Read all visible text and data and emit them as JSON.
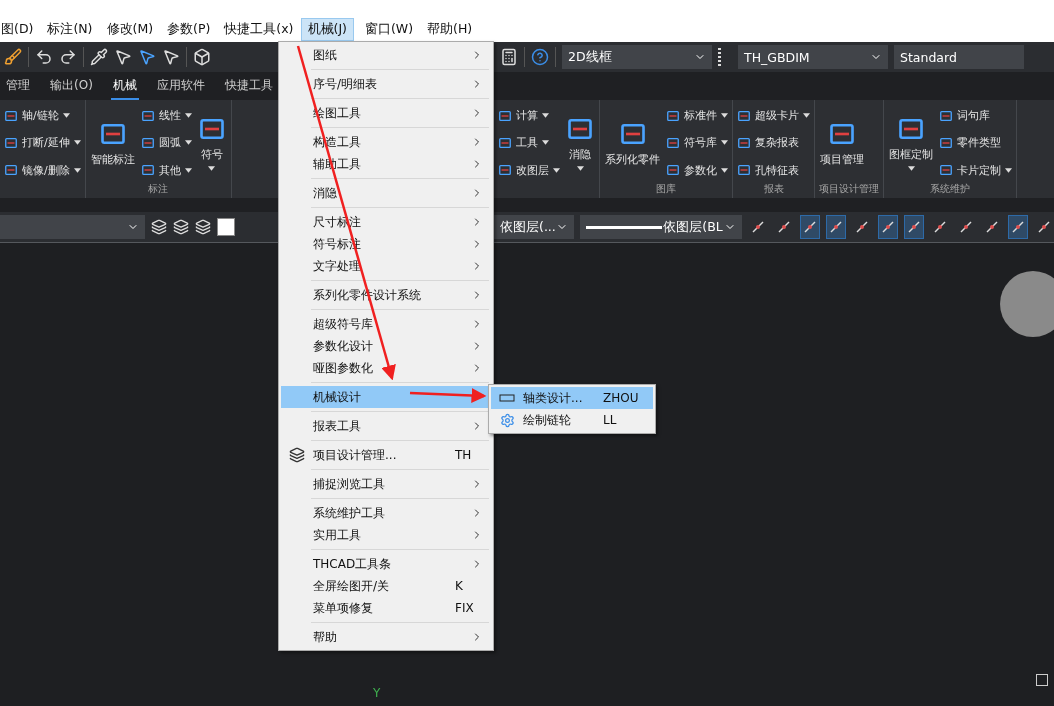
{
  "menubar": [
    {
      "label": "图(D)",
      "selected": false
    },
    {
      "label": "标注(N)",
      "selected": false
    },
    {
      "label": "修改(M)",
      "selected": false
    },
    {
      "label": "参数(P)",
      "selected": false
    },
    {
      "label": "快捷工具(x)",
      "selected": false
    },
    {
      "label": "机械(J)",
      "selected": true
    },
    {
      "label": "窗口(W)",
      "selected": false
    },
    {
      "label": "帮助(H)",
      "selected": false
    }
  ],
  "toolbar": {
    "visual_style": "2D线框",
    "dim_style": "TH_GBDIM",
    "text_style": "Standard"
  },
  "ribbon_tabs": [
    {
      "label": "管理",
      "selected": false
    },
    {
      "label": "输出(O)",
      "selected": false
    },
    {
      "label": "机械",
      "selected": true
    },
    {
      "label": "应用软件",
      "selected": false
    },
    {
      "label": "快捷工具",
      "selected": false
    }
  ],
  "ribbon_left": [
    {
      "buttons": [
        {
          "kind": "stack",
          "items": [
            {
              "label": "轴/链轮",
              "caret": true
            },
            {
              "label": "打断/延伸",
              "caret": true
            },
            {
              "label": "镜像/删除",
              "caret": true
            }
          ]
        }
      ]
    },
    {
      "title": "标注",
      "buttons": [
        {
          "kind": "large",
          "label": "智能标注",
          "caret": false
        },
        {
          "kind": "stack",
          "items": [
            {
              "label": "线性",
              "caret": true
            },
            {
              "label": "圆弧",
              "caret": true
            },
            {
              "label": "其他",
              "caret": true
            }
          ]
        },
        {
          "kind": "large",
          "label": "符号",
          "caret": true
        }
      ]
    }
  ],
  "ribbon_right": [
    {
      "buttons": [
        {
          "kind": "stack",
          "items": [
            {
              "label": "计算",
              "caret": true
            },
            {
              "label": "工具",
              "caret": true
            },
            {
              "label": "改图层",
              "caret": true
            }
          ]
        },
        {
          "kind": "large",
          "label": "消隐",
          "caret": true
        }
      ]
    },
    {
      "title": "图库",
      "buttons": [
        {
          "kind": "large",
          "label": "系列化零件",
          "caret": false
        },
        {
          "kind": "stack",
          "items": [
            {
              "label": "标准件",
              "caret": true
            },
            {
              "label": "符号库",
              "caret": true
            },
            {
              "label": "参数化",
              "caret": true
            }
          ]
        }
      ]
    },
    {
      "title": "报表",
      "buttons": [
        {
          "kind": "stack",
          "items": [
            {
              "label": "超级卡片",
              "caret": true
            },
            {
              "label": "复杂报表",
              "caret": false
            },
            {
              "label": "孔特征表",
              "caret": false
            }
          ]
        }
      ]
    },
    {
      "title": "项目设计管理",
      "buttons": [
        {
          "kind": "large",
          "label": "项目管理",
          "caret": false
        }
      ]
    },
    {
      "title": "系统维护",
      "buttons": [
        {
          "kind": "large",
          "label": "图框定制",
          "caret": true
        },
        {
          "kind": "stack",
          "items": [
            {
              "label": "词句库",
              "caret": false
            },
            {
              "label": "零件类型",
              "caret": false
            },
            {
              "label": "卡片定制",
              "caret": true
            }
          ]
        }
      ]
    }
  ],
  "properties": {
    "layer": "依图层(...",
    "linetype": "依图层(BL"
  },
  "snap_buttons": [
    {
      "on": false
    },
    {
      "on": false
    },
    {
      "on": true
    },
    {
      "on": true
    },
    {
      "on": false
    },
    {
      "on": true
    },
    {
      "on": true
    },
    {
      "on": false
    },
    {
      "on": false
    },
    {
      "on": false
    },
    {
      "on": true
    },
    {
      "on": false
    }
  ],
  "menu": {
    "groups": [
      [
        {
          "label": "图纸",
          "kind": "submenu",
          "selected": false
        }
      ],
      [
        {
          "label": "序号/明细表",
          "kind": "submenu",
          "selected": false
        }
      ],
      [
        {
          "label": "绘图工具",
          "kind": "submenu",
          "selected": false
        }
      ],
      [
        {
          "label": "构造工具",
          "kind": "submenu",
          "selected": false
        },
        {
          "label": "辅助工具",
          "kind": "submenu",
          "selected": false
        }
      ],
      [
        {
          "label": "消隐",
          "kind": "submenu",
          "selected": false
        }
      ],
      [
        {
          "label": "尺寸标注",
          "kind": "submenu",
          "selected": false
        },
        {
          "label": "符号标注",
          "kind": "submenu",
          "selected": false
        },
        {
          "label": "文字处理",
          "kind": "submenu",
          "selected": false
        }
      ],
      [
        {
          "label": "系列化零件设计系统",
          "kind": "submenu",
          "selected": false
        }
      ],
      [
        {
          "label": "超级符号库",
          "kind": "submenu",
          "selected": false
        },
        {
          "label": "参数化设计",
          "kind": "submenu",
          "selected": false
        },
        {
          "label": "哑图参数化",
          "kind": "submenu",
          "selected": false
        }
      ],
      [
        {
          "label": "机械设计",
          "kind": "submenu",
          "selected": true
        }
      ],
      [
        {
          "label": "报表工具",
          "kind": "submenu",
          "selected": false
        }
      ],
      [
        {
          "label": "项目设计管理...",
          "kind": "command",
          "shortcut": "TH",
          "icon": true,
          "selected": false
        }
      ],
      [
        {
          "label": "捕捉浏览工具",
          "kind": "submenu",
          "selected": false
        }
      ],
      [
        {
          "label": "系统维护工具",
          "kind": "submenu",
          "selected": false
        },
        {
          "label": "实用工具",
          "kind": "submenu",
          "selected": false
        }
      ],
      [
        {
          "label": "THCAD工具条",
          "kind": "submenu",
          "selected": false
        },
        {
          "label": "全屏绘图开/关",
          "kind": "command",
          "shortcut": "K",
          "selected": false
        },
        {
          "label": "菜单项修复",
          "kind": "command",
          "shortcut": "FIX",
          "selected": false
        }
      ],
      [
        {
          "label": "帮助",
          "kind": "submenu",
          "selected": false
        }
      ]
    ]
  },
  "submenu": [
    {
      "label": "轴类设计...",
      "shortcut": "ZHOU",
      "kind": "shaft",
      "selected": true
    },
    {
      "label": "绘制链轮",
      "shortcut": "LL",
      "kind": "gear",
      "selected": false
    }
  ],
  "canvas": {
    "axis_label": "Y"
  }
}
